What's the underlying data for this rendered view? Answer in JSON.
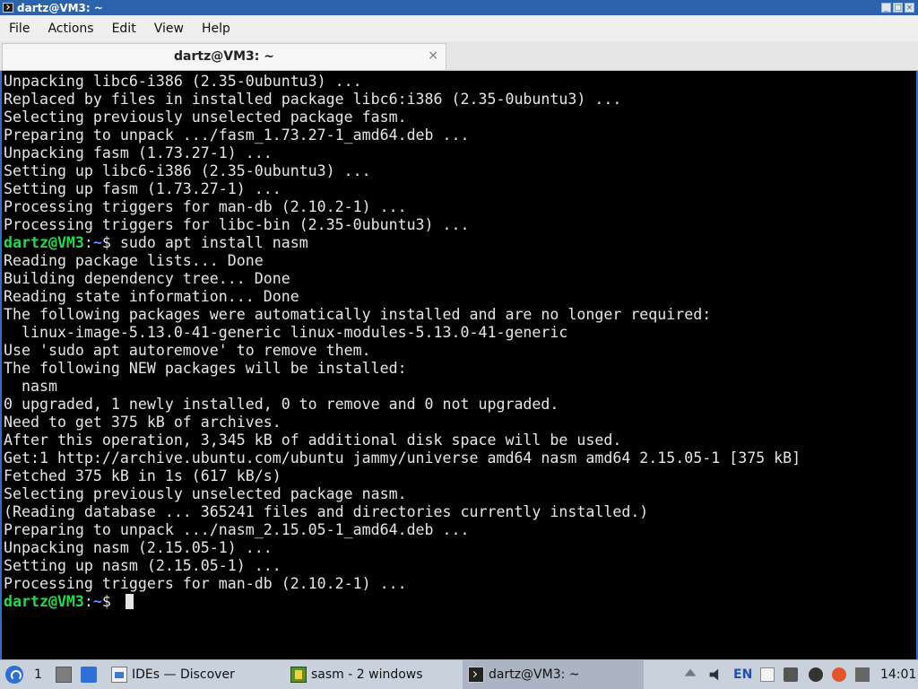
{
  "window": {
    "title": "dartz@VM3: ~",
    "controls": [
      "_",
      "□",
      "×"
    ]
  },
  "menu": [
    "File",
    "Actions",
    "Edit",
    "View",
    "Help"
  ],
  "tab": {
    "label": "dartz@VM3: ~",
    "close_glyph": "×"
  },
  "prompt": {
    "user_host": "dartz@VM3",
    "sep": ":",
    "path": "~",
    "dollar": "$"
  },
  "terminal_lines": [
    {
      "text": "Unpacking libc6-i386 (2.35-0ubuntu3) ..."
    },
    {
      "text": "Replaced by files in installed package libc6:i386 (2.35-0ubuntu3) ..."
    },
    {
      "text": "Selecting previously unselected package fasm."
    },
    {
      "text": "Preparing to unpack .../fasm_1.73.27-1_amd64.deb ..."
    },
    {
      "text": "Unpacking fasm (1.73.27-1) ..."
    },
    {
      "text": "Setting up libc6-i386 (2.35-0ubuntu3) ..."
    },
    {
      "text": "Setting up fasm (1.73.27-1) ..."
    },
    {
      "text": "Processing triggers for man-db (2.10.2-1) ..."
    },
    {
      "text": "Processing triggers for libc-bin (2.35-0ubuntu3) ..."
    },
    {
      "prompt": true,
      "cmd": " sudo apt install nasm"
    },
    {
      "text": "Reading package lists... Done"
    },
    {
      "text": "Building dependency tree... Done"
    },
    {
      "text": "Reading state information... Done"
    },
    {
      "text": "The following packages were automatically installed and are no longer required:"
    },
    {
      "text": "  linux-image-5.13.0-41-generic linux-modules-5.13.0-41-generic"
    },
    {
      "text": "Use 'sudo apt autoremove' to remove them."
    },
    {
      "text": "The following NEW packages will be installed:"
    },
    {
      "text": "  nasm"
    },
    {
      "text": "0 upgraded, 1 newly installed, 0 to remove and 0 not upgraded."
    },
    {
      "text": "Need to get 375 kB of archives."
    },
    {
      "text": "After this operation, 3,345 kB of additional disk space will be used."
    },
    {
      "text": "Get:1 http://archive.ubuntu.com/ubuntu jammy/universe amd64 nasm amd64 2.15.05-1 [375 kB]"
    },
    {
      "text": "Fetched 375 kB in 1s (617 kB/s)"
    },
    {
      "text": "Selecting previously unselected package nasm."
    },
    {
      "text": "(Reading database ... 365241 files and directories currently installed.)"
    },
    {
      "text": "Preparing to unpack .../nasm_2.15.05-1_amd64.deb ..."
    },
    {
      "text": "Unpacking nasm (2.15.05-1) ..."
    },
    {
      "text": "Setting up nasm (2.15.05-1) ..."
    },
    {
      "text": "Processing triggers for man-db (2.10.2-1) ..."
    },
    {
      "prompt": true,
      "cmd": " ",
      "cursor": true
    }
  ],
  "taskbar": {
    "workspace": "1",
    "tasks": [
      {
        "label": "IDEs — Discover",
        "icon": "discover-icon"
      },
      {
        "label": "sasm - 2 windows",
        "icon": "sasm-icon"
      },
      {
        "label": "dartz@VM3: ~",
        "icon": "terminal-icon",
        "active": true
      }
    ],
    "lang": "EN",
    "clock": "14:01"
  },
  "colors": {
    "prompt_user": "#27d84a",
    "prompt_path": "#5b8cff",
    "titlebar": "#2b63ad",
    "taskbar": "#c9d1dc"
  }
}
